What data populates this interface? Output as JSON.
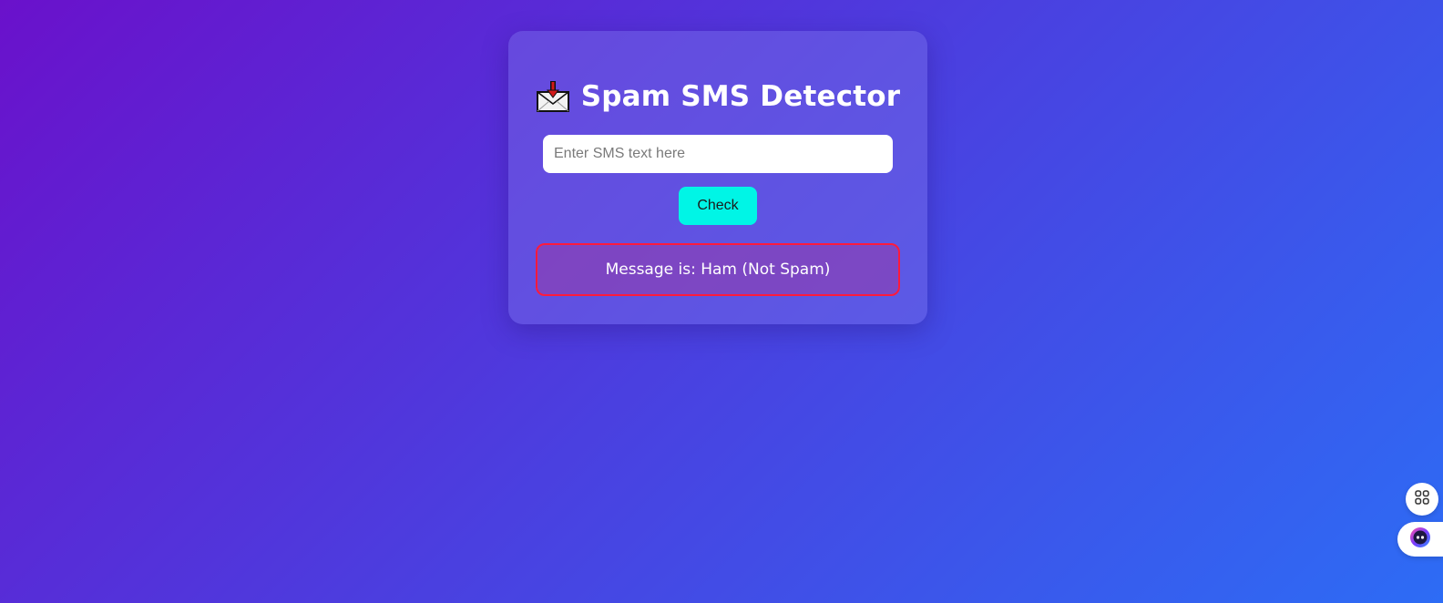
{
  "app": {
    "title": "Spam SMS Detector",
    "title_icon": "envelope-with-arrow-icon"
  },
  "form": {
    "input_value": "",
    "input_placeholder": "Enter SMS text here",
    "submit_label": "Check"
  },
  "result": {
    "text": "Message is: Ham (Not Spam)",
    "border_color": "#ff1a3c"
  },
  "floating_widgets": [
    {
      "icon": "apps-grid-icon"
    },
    {
      "icon": "assistant-face-icon"
    }
  ],
  "colors": {
    "gradient_start": "#6a11cb",
    "gradient_end": "#2d6cf5",
    "button_bg": "#00f5e6",
    "title_text": "#ffffff"
  }
}
